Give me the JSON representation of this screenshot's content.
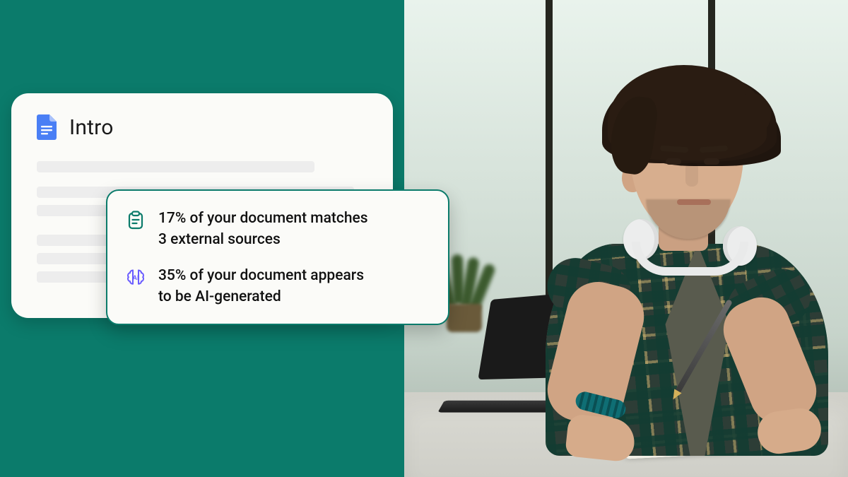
{
  "document": {
    "title": "Intro"
  },
  "results": {
    "plagiarism": {
      "line1": "17% of your document matches",
      "line2": "3 external sources"
    },
    "ai": {
      "line1": "35% of your document appears",
      "line2": "to be AI-generated"
    }
  },
  "icons": {
    "doc": "google-doc-icon",
    "clipboard": "clipboard-icon",
    "ai": "ai-brain-icon"
  }
}
